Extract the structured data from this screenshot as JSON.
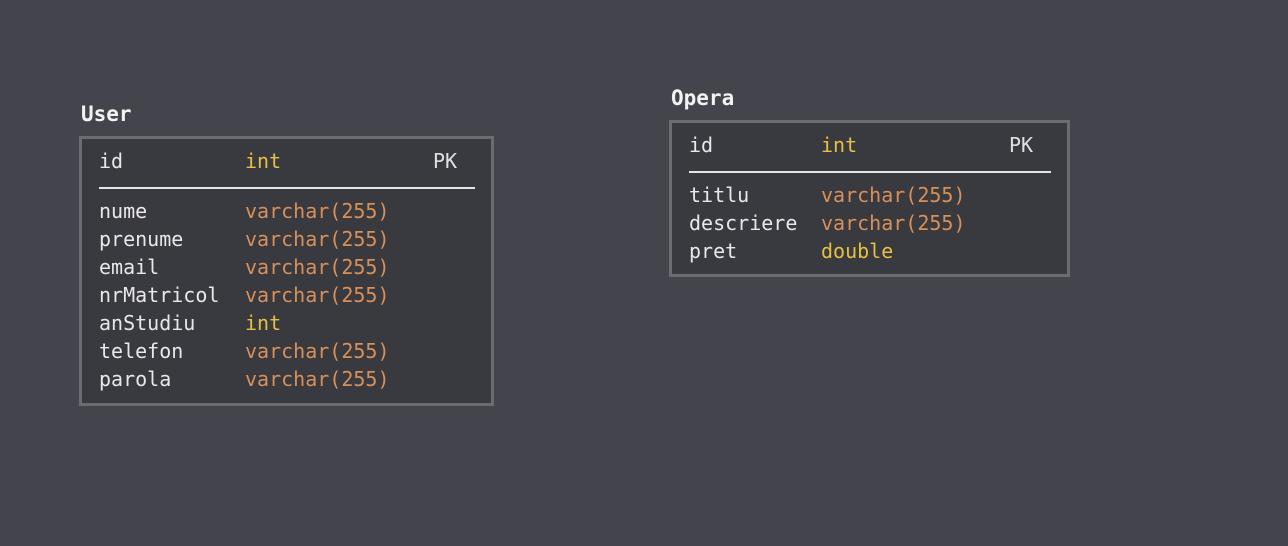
{
  "colors": {
    "background": "#44444c",
    "box_fill": "#393940",
    "box_border": "#6b6b72",
    "text": "#e8e8ea",
    "type_int": "#e6c040",
    "type_double": "#e6c040",
    "type_varchar": "#d89058"
  },
  "entities": [
    {
      "name": "User",
      "primary_key": {
        "name": "id",
        "type": "int",
        "key": "PK"
      },
      "fields": [
        {
          "name": "nume",
          "type": "varchar(255)"
        },
        {
          "name": "prenume",
          "type": "varchar(255)"
        },
        {
          "name": "email",
          "type": "varchar(255)"
        },
        {
          "name": "nrMatricol",
          "type": "varchar(255)"
        },
        {
          "name": "anStudiu",
          "type": "int"
        },
        {
          "name": "telefon",
          "type": "varchar(255)"
        },
        {
          "name": "parola",
          "type": "varchar(255)"
        }
      ]
    },
    {
      "name": "Opera",
      "primary_key": {
        "name": "id",
        "type": "int",
        "key": "PK"
      },
      "fields": [
        {
          "name": "titlu",
          "type": "varchar(255)"
        },
        {
          "name": "descriere",
          "type": "varchar(255)"
        },
        {
          "name": "pret",
          "type": "double"
        }
      ]
    }
  ]
}
